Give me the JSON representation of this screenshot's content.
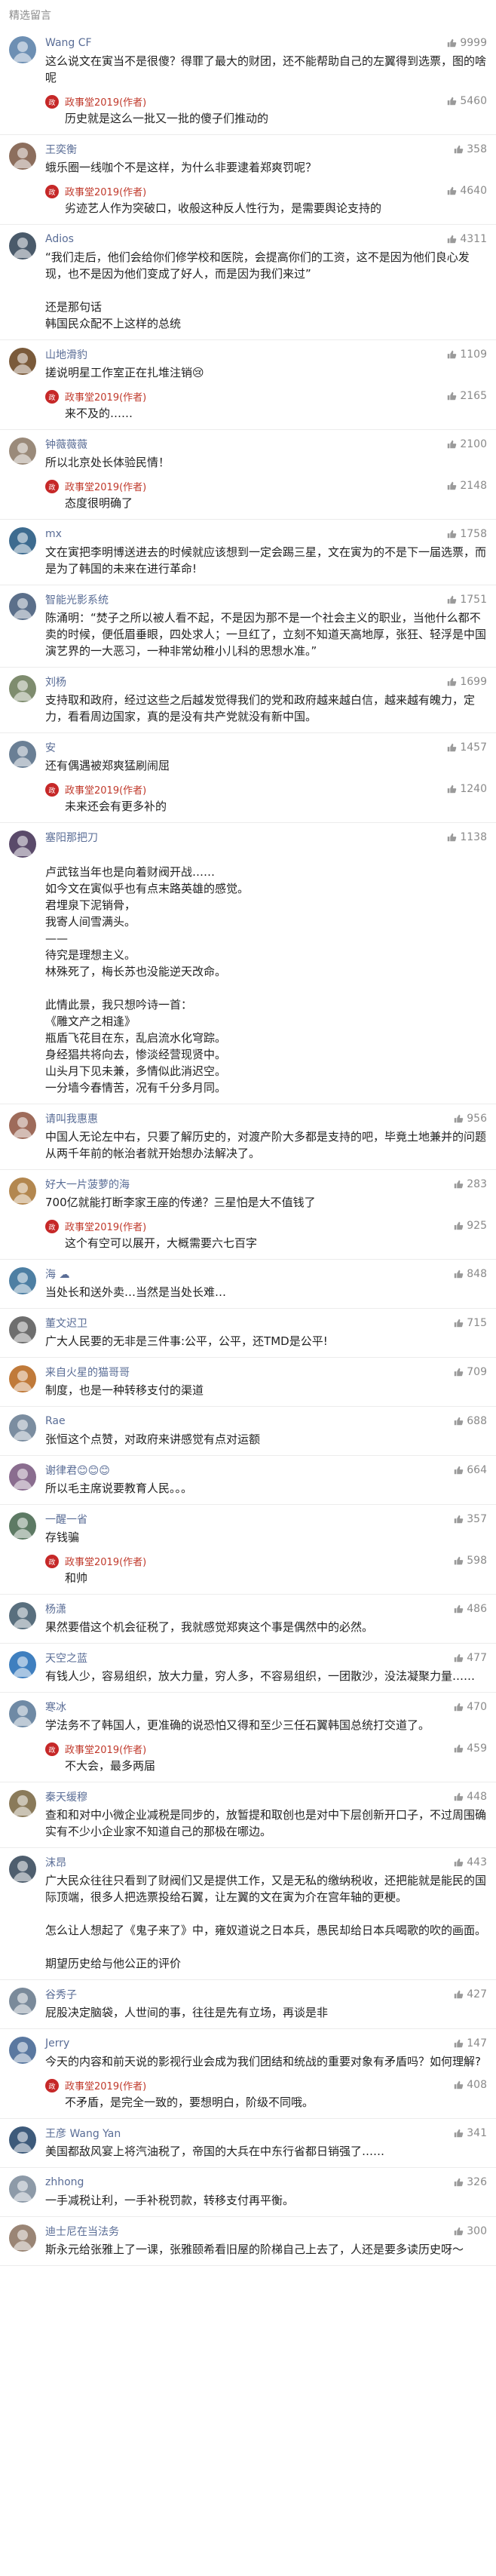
{
  "section_title": "精选留言",
  "reply_author": "政事堂2019(作者)",
  "comments": [
    {
      "name": "Wang CF",
      "likes": "9999",
      "text": [
        "这么说文在寅当不是很傻？得罪了最大的财团，还不能帮助自己的左翼得到选票，图的啥呢"
      ],
      "reply": {
        "likes": "5460",
        "text": [
          "历史就是这么一批又一批的傻子们推动的"
        ]
      },
      "avatar_color": "#6d8fb3",
      "avatar_char": "W"
    },
    {
      "name": "王奕衡",
      "likes": "358",
      "text": [
        "蛾乐圈一线咖个不是这样，为什么非要逮着郑爽罚呢？"
      ],
      "reply": {
        "likes": "4640",
        "text": [
          "劣迹艺人作为突破口，收般这种反人性行为，是需要舆论支持的"
        ]
      },
      "avatar_color": "#8c6e5d",
      "avatar_char": "王"
    },
    {
      "name": "Adios",
      "likes": "4311",
      "text": [
        "“我们走后，他们会给你们修学校和医院，会提高你们的工资，这不是因为他们良心发现，也不是因为他们变成了好人，而是因为我们来过”",
        "",
        "还是那句话",
        "韩国民众配不上这样的总统"
      ],
      "reply": null,
      "avatar_color": "#4a5a6a",
      "avatar_char": "A"
    },
    {
      "name": "山地滑豹",
      "likes": "1109",
      "text": [
        "搓说明星工作室正在扎堆注销😢"
      ],
      "reply": {
        "likes": "2165",
        "text": [
          "来不及的……"
        ]
      },
      "avatar_color": "#7a5a3a",
      "avatar_char": "山"
    },
    {
      "name": "钟薇薇薇",
      "likes": "2100",
      "text": [
        "所以北京处长体验民情！"
      ],
      "reply": {
        "likes": "2148",
        "text": [
          "态度很明确了"
        ]
      },
      "avatar_color": "#9a8a7a",
      "avatar_char": "钟"
    },
    {
      "name": "mx",
      "likes": "1758",
      "text": [
        "文在寅把李明博送进去的时候就应该想到一定会踢三星，文在寅为的不是下一届选票，而是为了韩国的未来在进行革命!"
      ],
      "reply": null,
      "avatar_color": "#3d6b8f",
      "avatar_char": "m"
    },
    {
      "name": "智能光影系统",
      "likes": "1751",
      "text": [
        "陈涌明：“焚子之所以被人看不起，不是因为那不是一个社会主义的职业，当他什么都不卖的时候，便低眉垂眼，四处求人；一旦红了，立刻不知道天高地厚，张狂、轻浮是中国演艺界的一大恶习，一种非常幼稚小儿科的思想水准。”"
      ],
      "reply": null,
      "avatar_color": "#5b6f8a",
      "avatar_char": "智"
    },
    {
      "name": "刘杨",
      "likes": "1699",
      "text": [
        "支持取和政府，经过这些之后越发觉得我们的党和政府越来越白信，越来越有魄力，定力，看看周边国家，真的是没有共产党就没有新中国。"
      ],
      "reply": null,
      "avatar_color": "#7e8c6e",
      "avatar_char": "刘"
    },
    {
      "name": "安",
      "likes": "1457",
      "text": [
        "还有偶遇被郑爽猛刷闹屈"
      ],
      "reply": {
        "likes": "1240",
        "text": [
          "未来还会有更多补的"
        ]
      },
      "avatar_color": "#6a7f95",
      "avatar_char": "安"
    },
    {
      "name": "塞阳那把刀",
      "likes": "1138",
      "text": [
        "",
        "卢武铉当年也是向着财阀开战……",
        "如今文在寅似乎也有点末路英雄的感觉。",
        "君埋泉下泥销骨，",
        "我寄人间雪满头。",
        "——",
        "待究是理想主义。",
        "林殊死了，梅长苏也没能逆天改命。",
        "",
        "此情此景，我只想吟诗一首：",
        "《雕文产之相逢》",
        "瓶盾飞花目在东，乱启流水化穹踪。",
        "身经猖共将向去，惨淡经营现贤中。",
        "山头月下见未兼，多情似此消迟空。",
        "一分墙今春情苦，况有千分多月同。"
      ],
      "reply": null,
      "avatar_color": "#5a4a6a",
      "avatar_char": "塞"
    },
    {
      "name": "请叫我惠惠",
      "likes": "956",
      "text": [
        "中国人无论左中右，只要了解历史的，对渡产阶大多都是支持的吧，毕竟土地兼并的问题从两千年前的帐治者就开始想办法解决了。"
      ],
      "reply": null,
      "avatar_color": "#9e6b5a",
      "avatar_char": "请"
    },
    {
      "name": "好大一片菠萝的海",
      "likes": "283",
      "text": [
        "700亿就能打断李家王座的传递？三星怕是大不值钱了"
      ],
      "reply": {
        "likes": "925",
        "text": [
          "这个有空可以展开，大概需要六七百字"
        ]
      },
      "avatar_color": "#b3874f",
      "avatar_char": "好"
    },
    {
      "name": "海 ☁",
      "likes": "848",
      "text": [
        "当处长和送外卖…当然是当处长难…"
      ],
      "reply": null,
      "avatar_color": "#4d7fa3",
      "avatar_char": "海"
    },
    {
      "name": "董文迟卫",
      "likes": "715",
      "text": [
        "广大人民要的无非是三件事:公平，公平，还TMD是公平!"
      ],
      "reply": null,
      "avatar_color": "#6e6e6e",
      "avatar_char": "董"
    },
    {
      "name": "来自火星的猫哥哥",
      "likes": "709",
      "text": [
        "制度，也是一种转移支付的渠道"
      ],
      "reply": null,
      "avatar_color": "#c07a3a",
      "avatar_char": "来"
    },
    {
      "name": "Rae",
      "likes": "688",
      "text": [
        "张恒这个点赞，对政府来讲感觉有点对运额"
      ],
      "reply": null,
      "avatar_color": "#7b8da0",
      "avatar_char": "R"
    },
    {
      "name": "谢律君😊😊😊",
      "likes": "664",
      "text": [
        "所以毛主席说要教育人民。。。"
      ],
      "reply": null,
      "avatar_color": "#8a6d8f",
      "avatar_char": "谢"
    },
    {
      "name": "一醒一省",
      "likes": "357",
      "text": [
        "存钱骗"
      ],
      "reply": {
        "likes": "598",
        "text": [
          "和帅"
        ]
      },
      "avatar_color": "#5d7a64",
      "avatar_char": "一"
    },
    {
      "name": "杨潇",
      "likes": "486",
      "text": [
        "果然要借这个机会征税了，我就感觉郑爽这个事是偶然中的必然。"
      ],
      "reply": null,
      "avatar_color": "#596f7e",
      "avatar_char": "杨"
    },
    {
      "name": "天空之蓝",
      "likes": "477",
      "text": [
        "有钱人少，容易组织，放大力量，穷人多，不容易组织，一团散沙，没法凝聚力量……"
      ],
      "reply": null,
      "avatar_color": "#3f7fbf",
      "avatar_char": "天"
    },
    {
      "name": "寒冰",
      "likes": "470",
      "text": [
        "学法务不了韩国人，更准确的说恐怕又得和至少三任石翼韩国总统打交道了。"
      ],
      "reply": {
        "likes": "459",
        "text": [
          "不大会，最多两届"
        ]
      },
      "avatar_color": "#6f8aa5",
      "avatar_char": "寒"
    },
    {
      "name": "秦天缓穆",
      "likes": "448",
      "text": [
        "查和和对中小微企业减税是同步的，放暂提和取创也是对中下层创新开口子，不过周围确实有不少小企业家不知道自己的那极在哪边。"
      ],
      "reply": null,
      "avatar_color": "#8a7a5a",
      "avatar_char": "秦"
    },
    {
      "name": "沫昂",
      "likes": "443",
      "text": [
        "广大民众往往只看到了财阀们又是提供工作，又是无私的缴纳税收，还把能就是能民的国际顶端，很多人把选票投给石翼，让左翼的文在寅为介在宫年轴的更梗。",
        "",
        "怎么让人想起了《鬼子来了》中，雍奴道说之日本兵，愚民却给日本兵喝歌的吹的画面。",
        "",
        "期望历史给与他公正的评价"
      ],
      "reply": null,
      "avatar_color": "#4e5e6e",
      "avatar_char": "沫"
    },
    {
      "name": "谷秀子",
      "likes": "427",
      "text": [
        "屁股决定脑袋，人世间的事，往往是先有立场，再谈是非"
      ],
      "reply": null,
      "avatar_color": "#7a8a9a",
      "avatar_char": "谷"
    },
    {
      "name": "Jerry",
      "likes": "147",
      "text": [
        "今天的内容和前天说的影视行业会成为我们团结和统战的重要对象有矛盾吗？如何理解?"
      ],
      "reply": {
        "likes": "408",
        "text": [
          "不矛盾，是完全一致的，要想明白，阶级不同哦。"
        ]
      },
      "avatar_color": "#5a78a0",
      "avatar_char": "J"
    },
    {
      "name": "王彦 Wang Yan",
      "likes": "341",
      "text": [
        "美国都敌风宴上将汽油税了，帝国的大兵在中东行省都日销强了……"
      ],
      "reply": null,
      "avatar_color": "#3d5a7a",
      "avatar_char": "王"
    },
    {
      "name": "zhhong",
      "likes": "326",
      "text": [
        "一手减税让利，一手补税罚款，转移支付再平衡。"
      ],
      "reply": null,
      "avatar_color": "#8d9aa8",
      "avatar_char": "z"
    },
    {
      "name": "迪士尼在当法务",
      "likes": "300",
      "text": [
        "斯永元给张雅上了一课，张雅颐希看旧屋的阶梯自己上去了，人还是要多读历史呀～"
      ],
      "reply": null,
      "avatar_color": "#9a8575",
      "avatar_char": "迪"
    }
  ]
}
